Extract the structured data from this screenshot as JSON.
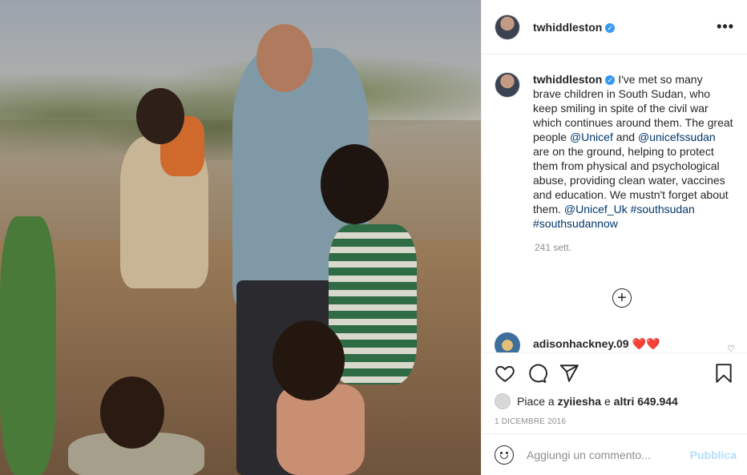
{
  "post": {
    "username": "twhiddleston",
    "verified": true,
    "more_icon": "more-options-icon"
  },
  "caption": {
    "username": "twhiddleston",
    "text_1": " I've met so many brave children in South Sudan, who keep smiling in spite of the civil war which continues around them. The great people ",
    "mention_1": "@Unicef",
    "text_2": " and ",
    "mention_2": "@unicefssudan",
    "text_3": " are on the ground, helping to protect them from physical and psychological abuse, providing clean water, vaccines and education. We mustn't forget about them. ",
    "mention_3": "@Unicef_Uk",
    "hashtag_1": "#southsudan",
    "hashtag_2": "#southsudannow",
    "time_ago": "241 sett."
  },
  "comment": {
    "username": "adisonhackney.09",
    "text": "❤️❤️"
  },
  "actions": {
    "likes_prefix": "Piace a ",
    "likes_user": "zyiiesha",
    "likes_mid": " e ",
    "likes_count": "altri 649.944",
    "date": "1 DICEMBRE 2016"
  },
  "add_comment": {
    "placeholder": "Aggiungi un commento...",
    "publish_label": "Pubblica"
  },
  "colors": {
    "link": "#00376b",
    "verified": "#3897f0",
    "publish_disabled": "#b2dffc"
  }
}
